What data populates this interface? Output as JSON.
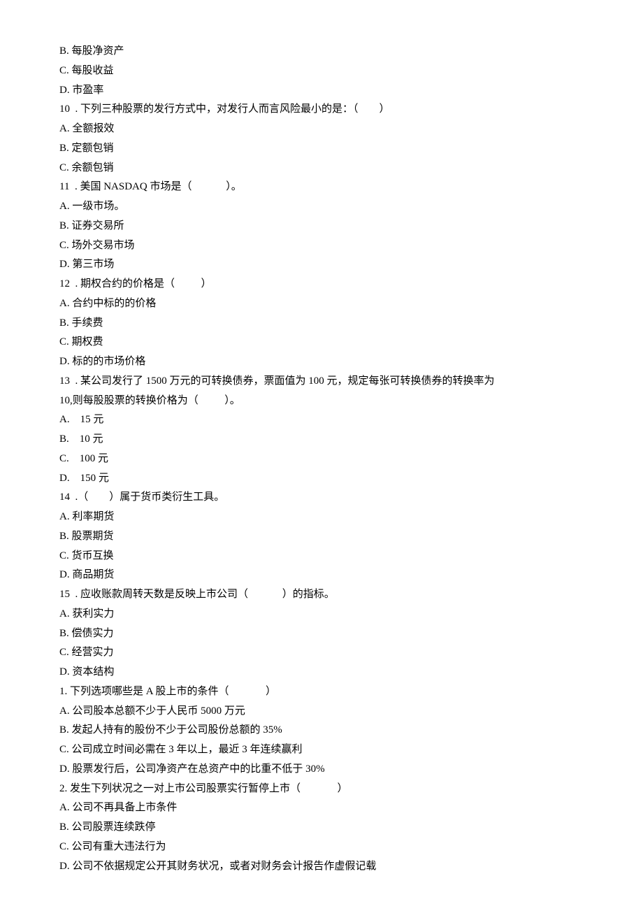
{
  "lines": [
    "B. 每股净资产",
    "C. 每股收益",
    "D. 市盈率",
    "10  . 下列三种股票的发行方式中，对发行人而言风险最小的是：（        ）",
    "A. 全额报效",
    "B. 定额包销",
    "C. 余额包销",
    "11  . 美国 NASDAQ 市场是（             ）。",
    "A. 一级市场。",
    "B. 证券交易所",
    "C. 场外交易市场",
    "D. 第三市场",
    "12  . 期权合约的价格是（          ）",
    "A. 合约中标的的价格",
    "B. 手续费",
    "C. 期权费",
    "D. 标的的市场价格",
    "13  . 某公司发行了 1500 万元的可转换债券，票面值为 100 元，规定每张可转换债券的转换率为",
    "10,则每股股票的转换价格为（          ）。",
    "A.    15 元",
    "B.    10 元",
    "C.    100 元",
    "D.    150 元",
    "14  .（        ）属于货币类衍生工具。",
    "A. 利率期货",
    "B. 股票期货",
    "C. 货币互换",
    "D. 商品期货",
    "15  . 应收账款周转天数是反映上市公司（             ）的指标。",
    "A. 获利实力",
    "B. 偿债实力",
    "C. 经营实力",
    "D. 资本结构",
    "1. 下列选项哪些是 A 股上市的条件（              ）",
    "A. 公司股本总额不少于人民币 5000 万元",
    "B. 发起人持有的股份不少于公司股份总额的 35%",
    "C. 公司成立时间必需在 3 年以上，最近 3 年连续赢利",
    "D. 股票发行后，公司净资产在总资产中的比重不低于 30%",
    "2. 发生下列状况之一对上市公司股票实行暂停上市（              ）",
    "A. 公司不再具备上市条件",
    "B. 公司股票连续跌停",
    "C. 公司有重大违法行为",
    "D. 公司不依据规定公开其财务状况，或者对财务会计报告作虚假记载"
  ]
}
